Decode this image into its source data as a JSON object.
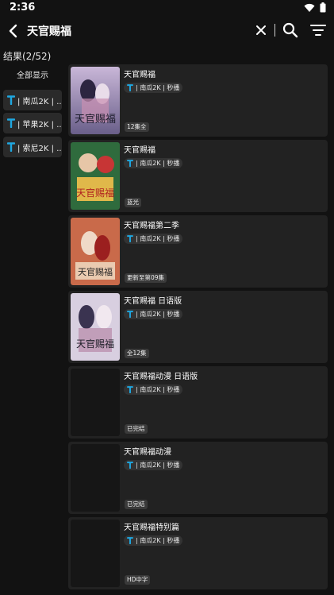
{
  "status_bar": {
    "time": "2:36"
  },
  "header": {
    "search_query": "天官赐福"
  },
  "results": {
    "count_label": "结果(2/52)"
  },
  "sidebar": {
    "show_all_label": "全部显示",
    "sources": [
      {
        "label": "| 南瓜2K | .."
      },
      {
        "label": "| 苹果2K | .."
      },
      {
        "label": "| 索尼2K | .."
      }
    ]
  },
  "cards": [
    {
      "title": "天官赐福",
      "tag": "| 南瓜2K | 秒播",
      "badge": "12集全",
      "poster": "poster-art-1"
    },
    {
      "title": "天官赐福",
      "tag": "| 南瓜2K | 秒播",
      "badge": "蓝光",
      "poster": "poster-art-2"
    },
    {
      "title": "天官赐福第二季",
      "tag": "| 南瓜2K | 秒播",
      "badge": "更新至第09集",
      "poster": "poster-art-3"
    },
    {
      "title": "天官赐福 日语版",
      "tag": "| 南瓜2K | 秒播",
      "badge": "全12集",
      "poster": "poster-art-4"
    },
    {
      "title": "天官赐福动漫 日语版",
      "tag": "| 南瓜2K | 秒播",
      "badge": "已完结",
      "poster": "blank"
    },
    {
      "title": "天官赐福动漫",
      "tag": "| 南瓜2K | 秒播",
      "badge": "已完结",
      "poster": "blank"
    },
    {
      "title": "天官赐福特别篇",
      "tag": "| 南瓜2K | 秒播",
      "badge": "HD中字",
      "poster": "blank"
    }
  ],
  "colors": {
    "background": "#121212",
    "card": "#222222",
    "accent_t": "#1fa7e0"
  }
}
